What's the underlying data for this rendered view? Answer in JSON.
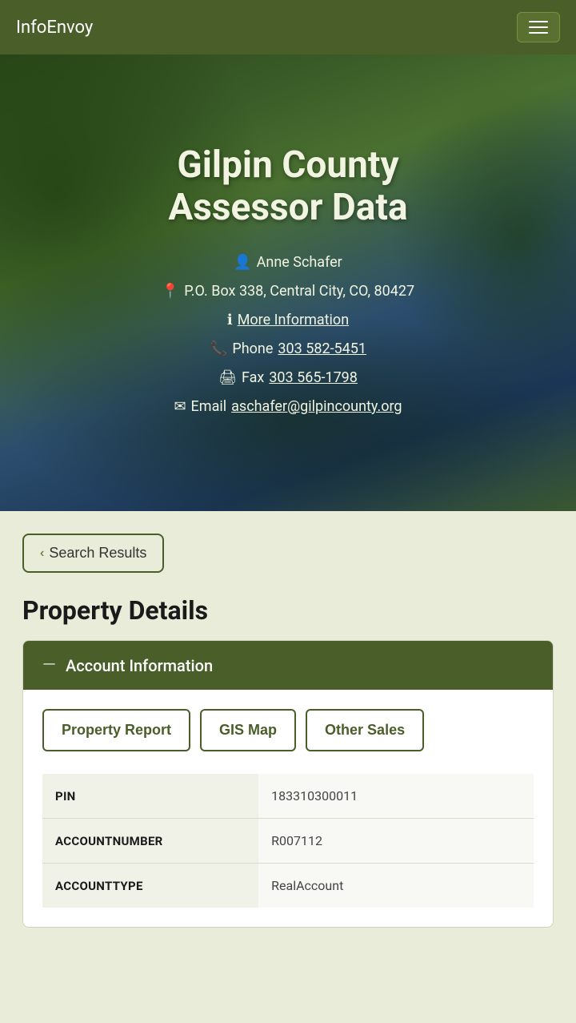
{
  "navbar": {
    "brand": "InfoEnvoy",
    "toggler_label": "Menu"
  },
  "hero": {
    "title_line1": "Gilpin County",
    "title_line2": "Assessor Data",
    "person_icon": "👤",
    "person_name": "Anne Schafer",
    "location_icon": "📍",
    "address": "P.O. Box 338, Central City, CO, 80427",
    "info_icon": "ℹ",
    "more_info_label": "More Information",
    "more_info_href": "#",
    "phone_icon": "📞",
    "phone_label": "Phone",
    "phone_number": "303 582-5451",
    "fax_icon": "🖨",
    "fax_label": "Fax",
    "fax_number": "303 565-1798",
    "email_icon": "✉",
    "email_label": "Email",
    "email_address": "aschafer@gilpincounty.org"
  },
  "search_results_button": "Search Results",
  "property_details_title": "Property Details",
  "card": {
    "header_dash": "—",
    "header_title": "Account Information",
    "buttons": [
      {
        "label": "Property Report"
      },
      {
        "label": "GIS Map"
      },
      {
        "label": "Other Sales"
      }
    ],
    "rows": [
      {
        "label": "PIN",
        "value": "183310300011"
      },
      {
        "label": "ACCOUNTNUMBER",
        "value": "R007112"
      },
      {
        "label": "ACCOUNTTYPE",
        "value": "RealAccount"
      }
    ]
  }
}
